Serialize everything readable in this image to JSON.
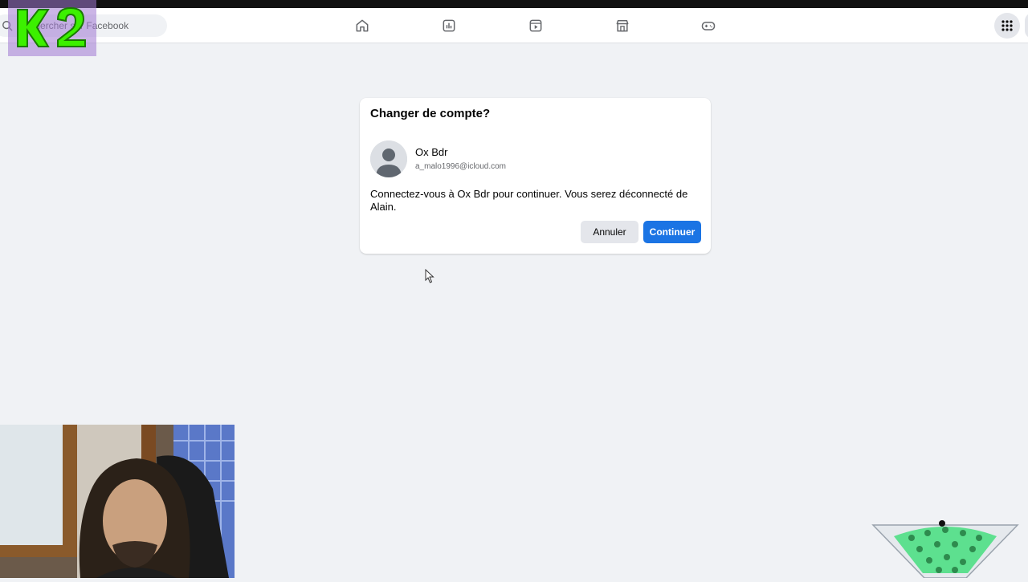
{
  "navbar": {
    "search_placeholder": "Rechercher sur Facebook",
    "tabs": [
      {
        "icon": "home-icon"
      },
      {
        "icon": "dashboard-icon"
      },
      {
        "icon": "video-icon"
      },
      {
        "icon": "marketplace-icon"
      },
      {
        "icon": "gaming-icon"
      }
    ],
    "apps_icon": "grid-menu-icon"
  },
  "overlay_logo": {
    "text": "K2",
    "color": "#3cf000"
  },
  "dialog": {
    "title": "Changer de compte?",
    "account_name": "Ox Bdr",
    "account_email": "a_malo1996@icloud.com",
    "message": "Connectez-vous à Ox Bdr pour continuer. Vous serez déconnecté de Alain.",
    "cancel_label": "Annuler",
    "continue_label": "Continuer"
  },
  "colors": {
    "background": "#f0f2f5",
    "primary": "#1b74e4",
    "secondary_button": "#e4e6eb"
  }
}
